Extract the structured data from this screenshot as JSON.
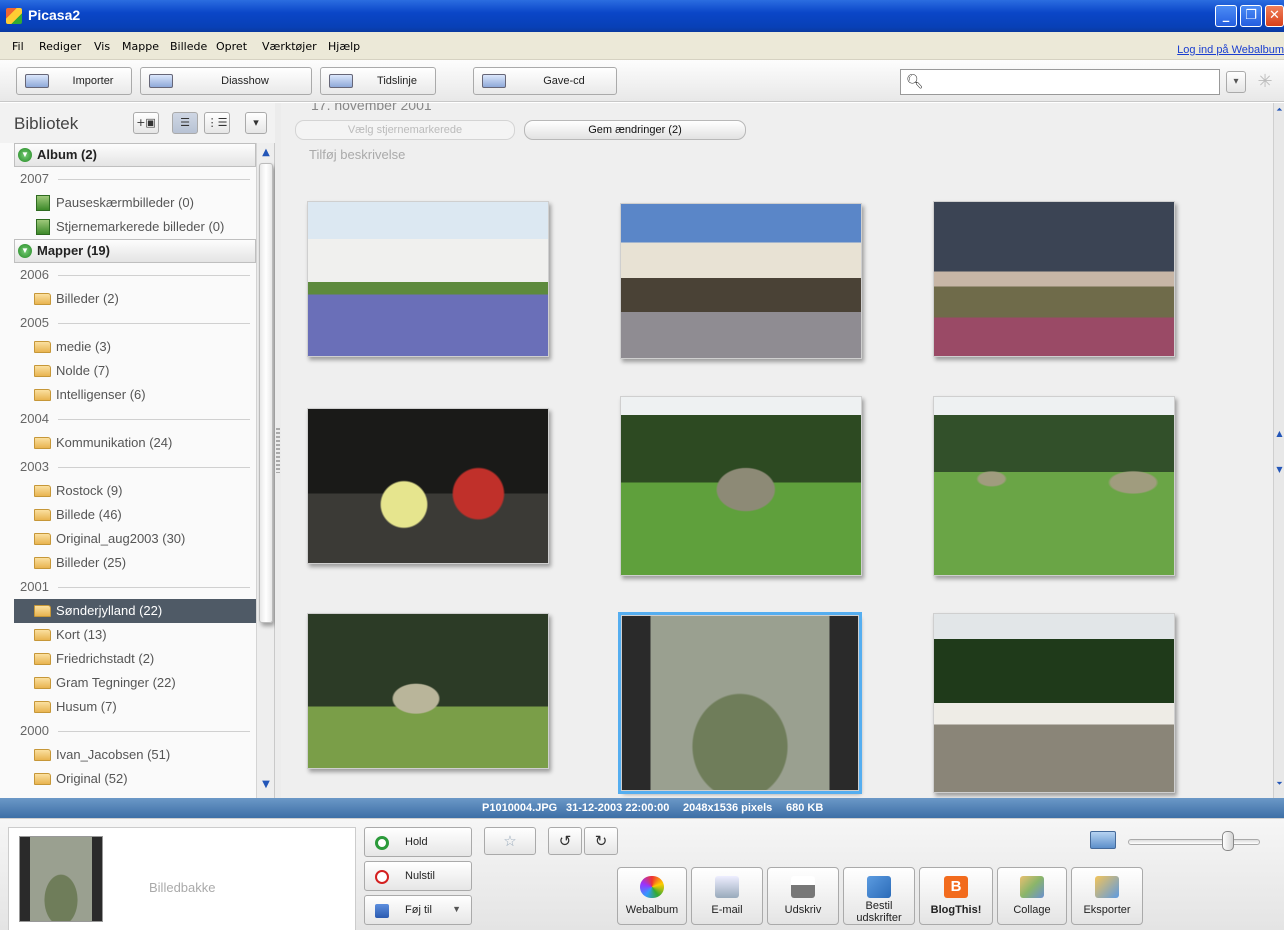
{
  "window": {
    "title": "Picasa2"
  },
  "menu": {
    "items": [
      "Fil",
      "Rediger",
      "Vis",
      "Mappe",
      "Billede",
      "Opret",
      "Værktøjer",
      "Hjælp"
    ],
    "login_link": "Log ind på Webalbum"
  },
  "toolbar": {
    "import_label": "Importer",
    "slideshow_label": "Diasshow",
    "timeline_label": "Tidslinje",
    "giftcd_label": "Gave-cd",
    "search_value": "",
    "search_placeholder": ""
  },
  "library": {
    "title": "Bibliotek",
    "albums_header": "Album (2)",
    "folders_header": "Mapper (19)",
    "rows": [
      {
        "type": "year",
        "label": "2007"
      },
      {
        "type": "album",
        "label": "Pauseskærmbilleder (0)"
      },
      {
        "type": "album",
        "label": "Stjernemarkerede billeder (0)"
      },
      {
        "type": "group",
        "label": "Mapper (19)"
      },
      {
        "type": "year",
        "label": "2006"
      },
      {
        "type": "folder",
        "label": "Billeder (2)"
      },
      {
        "type": "year",
        "label": "2005"
      },
      {
        "type": "folder",
        "label": "medie (3)"
      },
      {
        "type": "folder",
        "label": "Nolde (7)"
      },
      {
        "type": "folder",
        "label": "Intelligenser (6)"
      },
      {
        "type": "year",
        "label": "2004"
      },
      {
        "type": "folder",
        "label": "Kommunikation (24)"
      },
      {
        "type": "year",
        "label": "2003"
      },
      {
        "type": "folder",
        "label": "Rostock (9)"
      },
      {
        "type": "folder",
        "label": "Billede (46)"
      },
      {
        "type": "folder",
        "label": "Original_aug2003 (30)"
      },
      {
        "type": "folder",
        "label": "Billeder (25)"
      },
      {
        "type": "year",
        "label": "2001"
      },
      {
        "type": "folder",
        "label": "Sønderjylland (22)",
        "selected": true
      },
      {
        "type": "folder",
        "label": "Kort (13)"
      },
      {
        "type": "folder",
        "label": "Friedrichstadt (2)"
      },
      {
        "type": "folder",
        "label": "Gram Tegninger (22)"
      },
      {
        "type": "folder",
        "label": "Husum (7)"
      },
      {
        "type": "year",
        "label": "2000"
      },
      {
        "type": "folder",
        "label": "Ivan_Jacobsen (51)"
      },
      {
        "type": "folder",
        "label": "Original (52)"
      }
    ]
  },
  "main": {
    "folder_date": "17. november 2001",
    "starred_button": "Vælg stjernemarkerede",
    "save_button": "Gem ændringer (2)",
    "add_description": "Tilføj beskrivelse"
  },
  "status": {
    "filename": "P1010004.JPG",
    "datetime": "31-12-2003 22:00:00",
    "dimensions": "2048x1536 pixels",
    "size": "680 KB"
  },
  "tray": {
    "label": "Billedbakke",
    "hold_label": "Hold",
    "reset_label": "Nulstil",
    "add_to_label": "Føj til"
  },
  "actions": {
    "webalbum": "Webalbum",
    "email": "E-mail",
    "print": "Udskriv",
    "order_prints": "Bestil\nudskrifter",
    "blogthis": "BlogThis!",
    "collage": "Collage",
    "export": "Eksporter"
  },
  "colors": {
    "titlebar": "#0a46c8",
    "selection": "#4f5a66",
    "infobar": "#4a7bb2",
    "thumb_selected": "#55aef0"
  }
}
